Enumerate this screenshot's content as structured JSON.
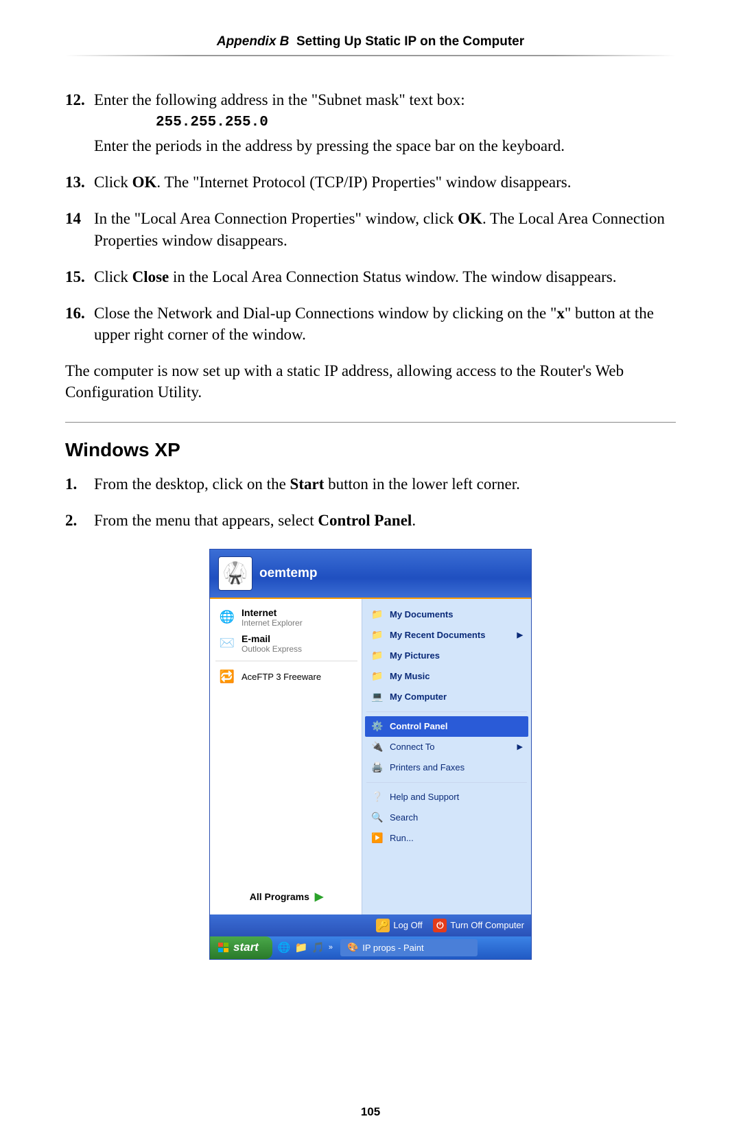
{
  "header": {
    "appendix": "Appendix B",
    "title": "Setting Up Static IP on the Computer"
  },
  "steps_a": [
    {
      "num": "12.",
      "text1": "Enter the following address in the \"Subnet mask\" text box:",
      "code": "255.255.255.0",
      "text2": "Enter the periods in the address by pressing the space bar on the keyboard."
    },
    {
      "num": "13.",
      "pre": "Click ",
      "bold": "OK",
      "post": ". The \"Internet Protocol (TCP/IP) Properties\" window disappears."
    },
    {
      "num": "14",
      "pre": "In the \"Local Area Connection Properties\" window, click ",
      "bold": "OK",
      "post": ". The Local Area Connection Properties window disappears."
    },
    {
      "num": "15.",
      "pre": "Click ",
      "bold": "Close",
      "post": " in the Local Area Connection Status window. The window disappears."
    },
    {
      "num": "16.",
      "pre": "Close the Network and Dial-up Connections window by clicking on the \"",
      "bold": "x",
      "post": "\" button at the upper right corner of the window."
    }
  ],
  "conclusion": "The computer is now set up with a static IP address, allowing access to the Router's Web Configuration Utility.",
  "section": "Windows XP",
  "steps_b": [
    {
      "num": "1.",
      "pre": "From the desktop, click on the ",
      "bold": "Start",
      "post": " button in the lower left corner."
    },
    {
      "num": "2.",
      "pre": "From the menu that appears, select ",
      "bold": "Control Panel",
      "post": "."
    }
  ],
  "startmenu": {
    "user": "oemtemp",
    "left": {
      "internet": {
        "title": "Internet",
        "sub": "Internet Explorer"
      },
      "email": {
        "title": "E-mail",
        "sub": "Outlook Express"
      },
      "app1": "AceFTP 3 Freeware",
      "allprograms": "All Programs"
    },
    "right": {
      "mydocs": "My Documents",
      "recent": "My Recent Documents",
      "pictures": "My Pictures",
      "music": "My Music",
      "computer": "My Computer",
      "controlpanel": "Control Panel",
      "connect": "Connect To",
      "printers": "Printers and Faxes",
      "help": "Help and Support",
      "search": "Search",
      "run": "Run..."
    },
    "bottom": {
      "logoff": "Log Off",
      "shutdown": "Turn Off Computer"
    }
  },
  "taskbar": {
    "start": "start",
    "task1": "IP props - Paint"
  },
  "page": "105"
}
